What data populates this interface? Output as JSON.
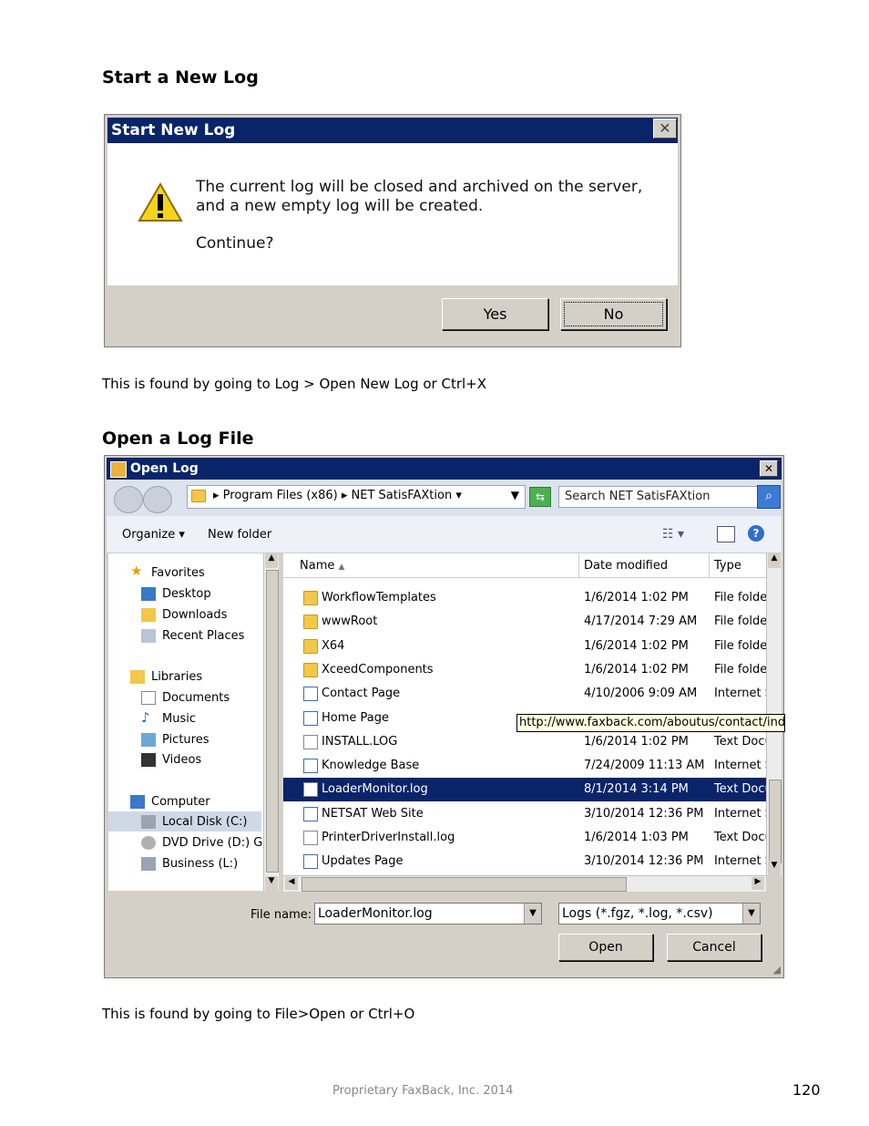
{
  "section1": {
    "heading": "Start a New Log",
    "dialog": {
      "title": "Start New Log",
      "close": "✕",
      "message": "The current log will be closed and archived on the server, and a new empty log will be created.",
      "question": "Continue?",
      "yes": "Yes",
      "no": "No"
    },
    "caption": "This is found by going to Log > Open New Log or Ctrl+X"
  },
  "section2": {
    "heading": "Open a Log File",
    "dialog": {
      "title": "Open Log",
      "close": "✕",
      "breadcrumb": [
        "Program Files (x86)",
        "NET SatisFAXtion"
      ],
      "search_placeholder": "Search NET SatisFAXtion",
      "organize": "Organize",
      "new_folder": "New folder",
      "nav": {
        "favorites": "Favorites",
        "fav_items": [
          "Desktop",
          "Downloads",
          "Recent Places"
        ],
        "libraries": "Libraries",
        "lib_items": [
          "Documents",
          "Music",
          "Pictures",
          "Videos"
        ],
        "computer": "Computer",
        "comp_items": [
          "Local Disk (C:)",
          "DVD Drive (D:) GRN",
          "Business (L:)"
        ]
      },
      "columns": {
        "name": "Name",
        "date": "Date modified",
        "type": "Type"
      },
      "files": [
        {
          "name": "WorkflowTemplates",
          "date": "1/6/2014 1:02 PM",
          "type": "File folder",
          "icon": "folder"
        },
        {
          "name": "wwwRoot",
          "date": "4/17/2014 7:29 AM",
          "type": "File folder",
          "icon": "folder"
        },
        {
          "name": "X64",
          "date": "1/6/2014 1:02 PM",
          "type": "File folder",
          "icon": "folder"
        },
        {
          "name": "XceedComponents",
          "date": "1/6/2014 1:02 PM",
          "type": "File folder",
          "icon": "folder"
        },
        {
          "name": "Contact Page",
          "date": "4/10/2006 9:09 AM",
          "type": "Internet Shortcut",
          "icon": "web"
        },
        {
          "name": "Home Page",
          "date": "",
          "type": "",
          "icon": "web"
        },
        {
          "name": "INSTALL.LOG",
          "date": "1/6/2014 1:02 PM",
          "type": "Text Document",
          "icon": "doc"
        },
        {
          "name": "Knowledge Base",
          "date": "7/24/2009 11:13 AM",
          "type": "Internet Shortcut",
          "icon": "web"
        },
        {
          "name": "LoaderMonitor.log",
          "date": "8/1/2014 3:14 PM",
          "type": "Text Document",
          "icon": "doc",
          "selected": true
        },
        {
          "name": "NETSAT Web Site",
          "date": "3/10/2014 12:36 PM",
          "type": "Internet Shortcut",
          "icon": "web"
        },
        {
          "name": "PrinterDriverInstall.log",
          "date": "1/6/2014 1:03 PM",
          "type": "Text Document",
          "icon": "doc"
        },
        {
          "name": "Updates Page",
          "date": "3/10/2014 12:36 PM",
          "type": "Internet Shortcut",
          "icon": "web"
        }
      ],
      "tooltip": "http://www.faxback.com/aboutus/contact/index.asp",
      "filename_label": "File name:",
      "filename_value": "LoaderMonitor.log",
      "filter": "Logs (*.fgz, *.log, *.csv)",
      "open": "Open",
      "cancel": "Cancel"
    },
    "caption": "This is found by going to File>Open or Ctrl+O"
  },
  "footer": {
    "center": "Proprietary FaxBack, Inc. 2014",
    "page": "120"
  }
}
